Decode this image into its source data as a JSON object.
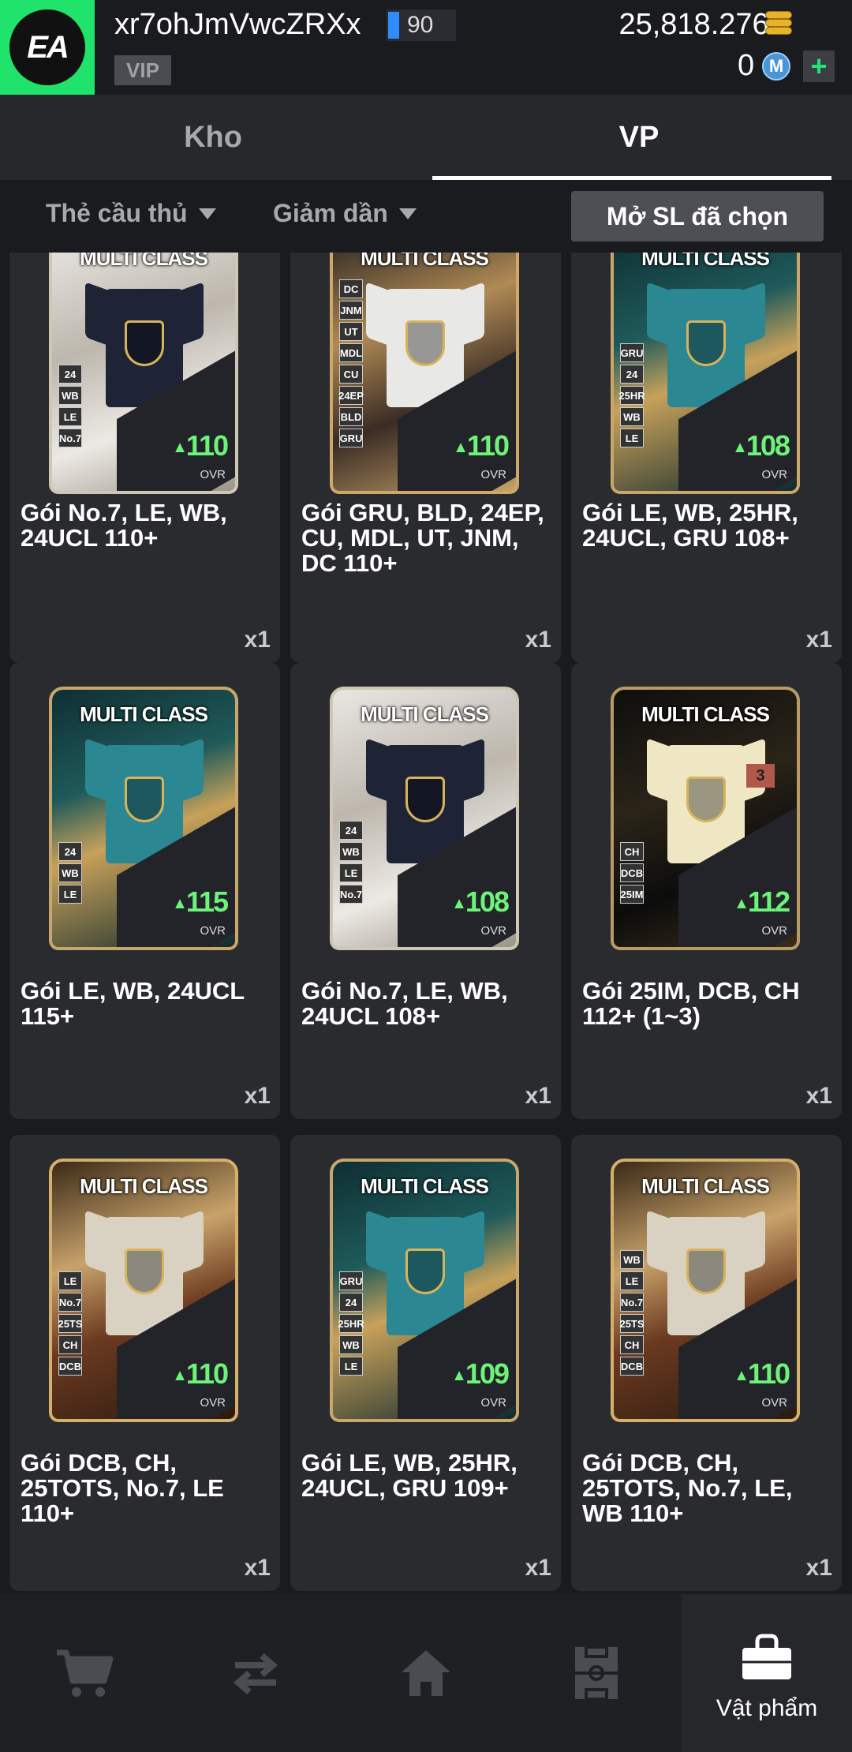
{
  "header": {
    "username": "xr7ohJmVwcZRXx",
    "level": "90",
    "vip_label": "VIP",
    "bp_amount": "25,818.276B",
    "m_amount": "0",
    "m_icon_text": "M",
    "plus": "+"
  },
  "tabs": [
    {
      "label": "Kho",
      "active": false
    },
    {
      "label": "VP",
      "active": true
    }
  ],
  "filters": {
    "type_label": "Thẻ cầu thủ",
    "sort_label": "Giảm dần",
    "open_selected_label": "Mở SL đã chọn"
  },
  "items": [
    {
      "name": "Gói No.7, LE, WB, 24UCL 110+",
      "qty": "x1",
      "ovr": "110",
      "theme": "silver",
      "badges": [
        "24",
        "WB",
        "LE",
        "No.7"
      ]
    },
    {
      "name": "Gói GRU, BLD, 24EP, CU, MDL, UT, JNM, DC 110+",
      "qty": "x1",
      "ovr": "110",
      "theme": "white",
      "badges": [
        "DC",
        "JNM",
        "UT",
        "MDL",
        "CU",
        "24EP",
        "BLD",
        "GRU"
      ]
    },
    {
      "name": "Gói LE, WB, 25HR, 24UCL, GRU 108+",
      "qty": "x1",
      "ovr": "108",
      "theme": "teal",
      "badges": [
        "GRU",
        "24",
        "25HR",
        "WB",
        "LE"
      ]
    },
    {
      "name": "Gói LE, WB, 24UCL 115+",
      "qty": "x1",
      "ovr": "115",
      "theme": "teal",
      "badges": [
        "24",
        "WB",
        "LE"
      ]
    },
    {
      "name": "Gói No.7, LE, WB, 24UCL 108+",
      "qty": "x1",
      "ovr": "108",
      "theme": "silver",
      "badges": [
        "24",
        "WB",
        "LE",
        "No.7"
      ]
    },
    {
      "name": "Gói 25IM, DCB, CH 112+ (1~3)",
      "qty": "x1",
      "ovr": "112",
      "theme": "cream",
      "badges": [
        "CH",
        "DCB",
        "25IM"
      ]
    },
    {
      "name": "Gói DCB, CH, 25TOTS, No.7, LE 110+",
      "qty": "x1",
      "ovr": "110",
      "theme": "gold",
      "badges": [
        "LE",
        "No.7",
        "25TS",
        "CH",
        "DCB"
      ]
    },
    {
      "name": "Gói LE, WB, 25HR, 24UCL, GRU 109+",
      "qty": "x1",
      "ovr": "109",
      "theme": "teal",
      "badges": [
        "GRU",
        "24",
        "25HR",
        "WB",
        "LE"
      ]
    },
    {
      "name": "Gói DCB, CH, 25TOTS, No.7, LE, WB 110+",
      "qty": "x1",
      "ovr": "110",
      "theme": "gold",
      "badges": [
        "WB",
        "LE",
        "No.7",
        "25TS",
        "CH",
        "DCB"
      ]
    }
  ],
  "card_labels": {
    "multi_class": "MULTI CLASS",
    "ovr": "OVR",
    "arrow": "▲",
    "rank": "3"
  },
  "nav": [
    {
      "icon": "cart-icon",
      "label": ""
    },
    {
      "icon": "transfer-icon",
      "label": ""
    },
    {
      "icon": "home-icon",
      "label": ""
    },
    {
      "icon": "squad-icon",
      "label": ""
    },
    {
      "icon": "items-bag-icon",
      "label": "Vật phẩm",
      "active": true
    }
  ],
  "colors": {
    "accent_green": "#1fe36a",
    "ovr_green": "#6df27a",
    "tab_underline": "#ffffff"
  }
}
